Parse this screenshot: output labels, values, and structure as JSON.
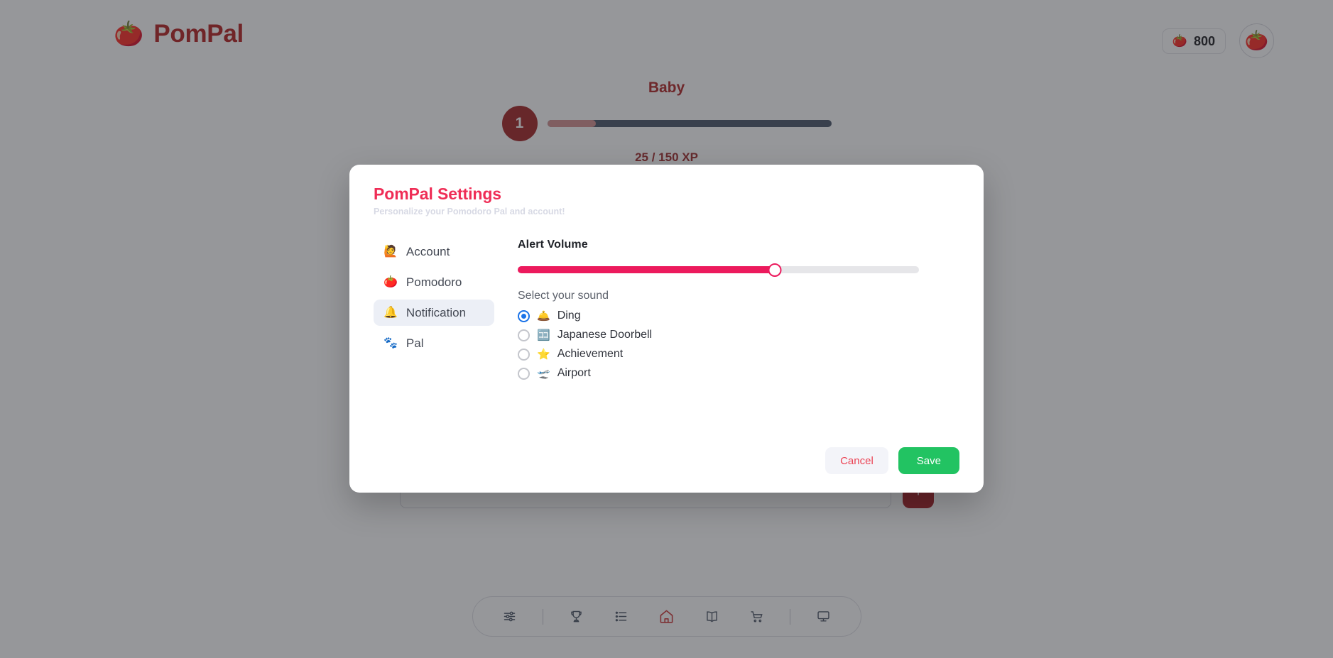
{
  "header": {
    "brand_icon": "tomato-icon",
    "brand_name": "PomPal",
    "coin_icon": "tomato-coin-icon",
    "coin_count": "800",
    "avatar_icon": "tomato-avatar-icon"
  },
  "xp": {
    "rank_title": "Baby",
    "level": "1",
    "progress_text": "25 / 150 XP",
    "progress_percent": 17
  },
  "task_bar": {
    "input_value": "",
    "input_placeholder": "",
    "submit_icon": "plus-icon"
  },
  "dock": {
    "items": [
      {
        "name": "dock-item-settings",
        "icon": "sliders-icon",
        "active": false
      },
      {
        "name": "dock-separator-1",
        "icon": "divider",
        "active": false
      },
      {
        "name": "dock-item-achievements",
        "icon": "trophy-icon",
        "active": false
      },
      {
        "name": "dock-item-tasks",
        "icon": "list-icon",
        "active": false
      },
      {
        "name": "dock-item-home",
        "icon": "home-icon",
        "active": true
      },
      {
        "name": "dock-item-library",
        "icon": "book-icon",
        "active": false
      },
      {
        "name": "dock-item-shop",
        "icon": "cart-icon",
        "active": false
      },
      {
        "name": "dock-separator-2",
        "icon": "divider",
        "active": false
      },
      {
        "name": "dock-item-desktop",
        "icon": "monitor-icon",
        "active": false
      }
    ]
  },
  "dialog": {
    "title": "PomPal Settings",
    "subtitle": "Personalize your Pomodoro Pal and account!",
    "nav": [
      {
        "label": "Account",
        "emoji": "🙋",
        "icon": "person-icon",
        "selected": false
      },
      {
        "label": "Pomodoro",
        "emoji": "🍅",
        "icon": "tomato-icon",
        "selected": false
      },
      {
        "label": "Notification",
        "emoji": "🔔",
        "icon": "bell-icon",
        "selected": true
      },
      {
        "label": "Pal",
        "emoji": "🐾",
        "icon": "paw-icon",
        "selected": false
      }
    ],
    "volume": {
      "label": "Alert Volume",
      "value_percent": 64
    },
    "sound": {
      "label": "Select your sound",
      "selected": "Ding",
      "options": [
        {
          "label": "Ding",
          "emoji": "🛎️",
          "icon": "bellhop-bell-icon",
          "checked": true
        },
        {
          "label": "Japanese Doorbell",
          "emoji": "🈁",
          "icon": "japanese-symbol-icon",
          "checked": false
        },
        {
          "label": "Achievement",
          "emoji": "⭐",
          "icon": "star-icon",
          "checked": false
        },
        {
          "label": "Airport",
          "emoji": "🛫",
          "icon": "airplane-departure-icon",
          "checked": false
        }
      ]
    },
    "cancel_label": "Cancel",
    "save_label": "Save"
  },
  "colors": {
    "brand_red": "#b42121",
    "dialog_accent": "#ef2d56",
    "slider_pink": "#ec1a5d",
    "save_green": "#22c362",
    "cancel_text": "#ec4455",
    "radio_blue": "#1a73e8",
    "selected_nav_bg": "#eceff6"
  }
}
